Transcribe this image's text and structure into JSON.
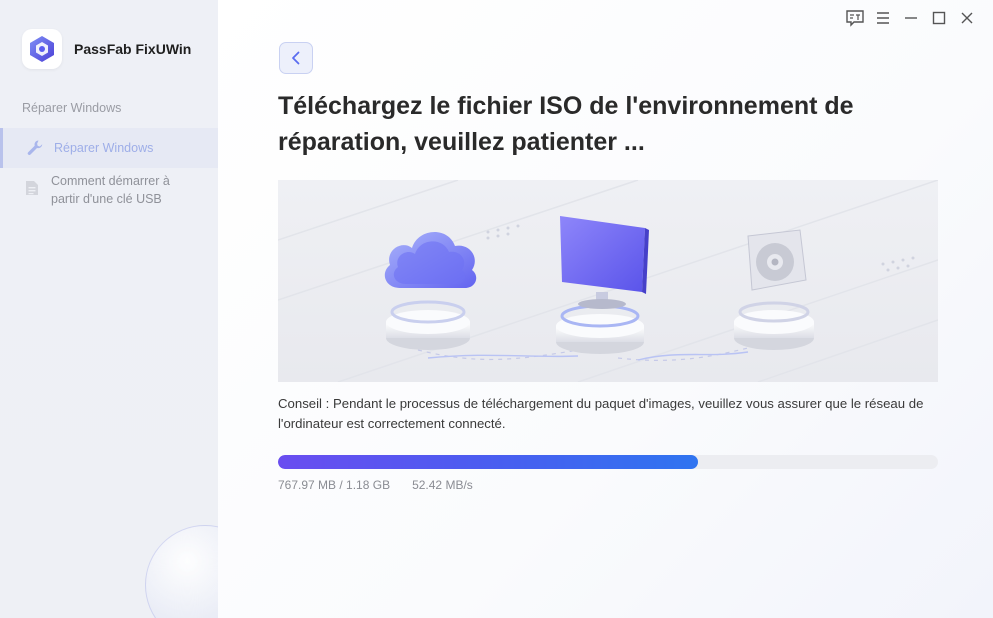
{
  "app": {
    "name": "PassFab FixUWin"
  },
  "sidebar": {
    "section_title": "Réparer Windows",
    "items": [
      {
        "label": "Réparer Windows",
        "icon": "wrench-icon",
        "active": true
      },
      {
        "label": "Comment démarrer à partir d'une clé USB",
        "icon": "document-icon",
        "active": false
      }
    ]
  },
  "titlebar": {
    "buttons": [
      "feedback-icon",
      "menu-icon",
      "minimize-icon",
      "maximize-icon",
      "close-icon"
    ]
  },
  "main": {
    "heading": "Téléchargez le fichier ISO de l'environnement de réparation, veuillez patienter ...",
    "tip": "Conseil : Pendant le processus de téléchargement du paquet d'images, veuillez vous assurer que le réseau de l'ordinateur est correctement connecté.",
    "progress": {
      "fraction": 0.636,
      "downloaded": "767.97 MB / 1.18 GB",
      "speed": "52.42 MB/s"
    }
  },
  "colors": {
    "accent": "#5b5cf0",
    "progress_start": "#6a4df0",
    "progress_end": "#2f74f0",
    "active_nav": "#9eaee8"
  }
}
